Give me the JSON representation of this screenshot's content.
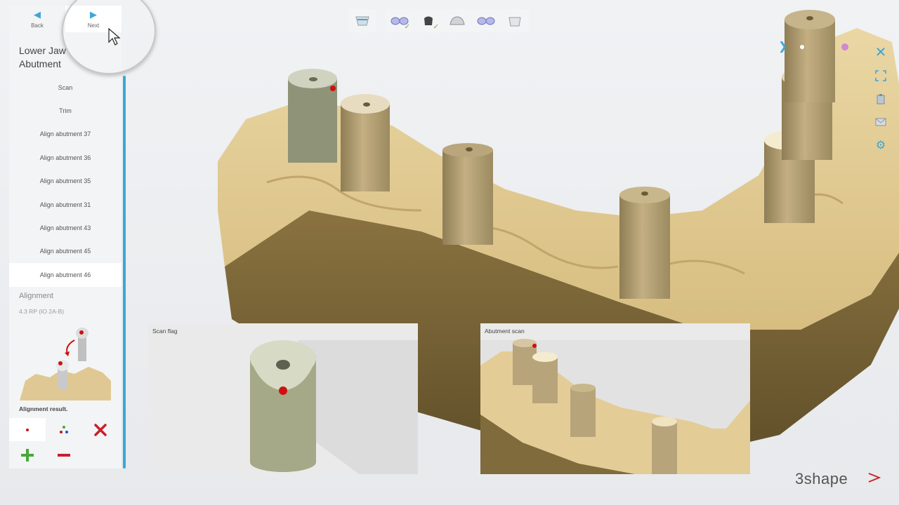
{
  "nav": {
    "back_label": "Back",
    "next_label": "Next"
  },
  "panel": {
    "title_line1": "Lower Jaw",
    "title_line2": "Abutment",
    "steps": [
      "Scan",
      "Trim",
      "Align abutment 37",
      "Align abutment 36",
      "Align abutment 35",
      "Align abutment 31",
      "Align abutment 43",
      "Align abutment 45",
      "Align abutment 46"
    ],
    "active_step": "Align abutment 46",
    "alignment_title": "Alignment",
    "alignment_sub": "4.3 RP (IO 2A-B)",
    "alignment_result": "Alignment result."
  },
  "workflow": {
    "steps": [
      {
        "icon": "cup-icon",
        "done": false
      },
      {
        "icon": "jaw-scan-icon",
        "done": true
      },
      {
        "icon": "abutment-icon",
        "done": true
      },
      {
        "icon": "upper-jaw-icon",
        "done": false
      },
      {
        "icon": "bite-icon",
        "done": false
      },
      {
        "icon": "preparation-icon",
        "done": false
      }
    ]
  },
  "right_tools": [
    "close-icon",
    "fullscreen-icon",
    "clipboard-icon",
    "mail-icon",
    "gear-icon"
  ],
  "previews": {
    "scan_flag_title": "Scan flag",
    "abutment_scan_title": "Abutment scan"
  },
  "brand": {
    "name": "3shape"
  },
  "colors": {
    "accent": "#3ca7d8",
    "check": "#69b63f",
    "model": "#e6d09a",
    "model_shadow": "#7a6433",
    "abutment": "#b8a47a",
    "scan_flag": "#a5a988",
    "marker_red": "#cc1111",
    "remove_red": "#c8202a",
    "add_green": "#45a83a"
  }
}
